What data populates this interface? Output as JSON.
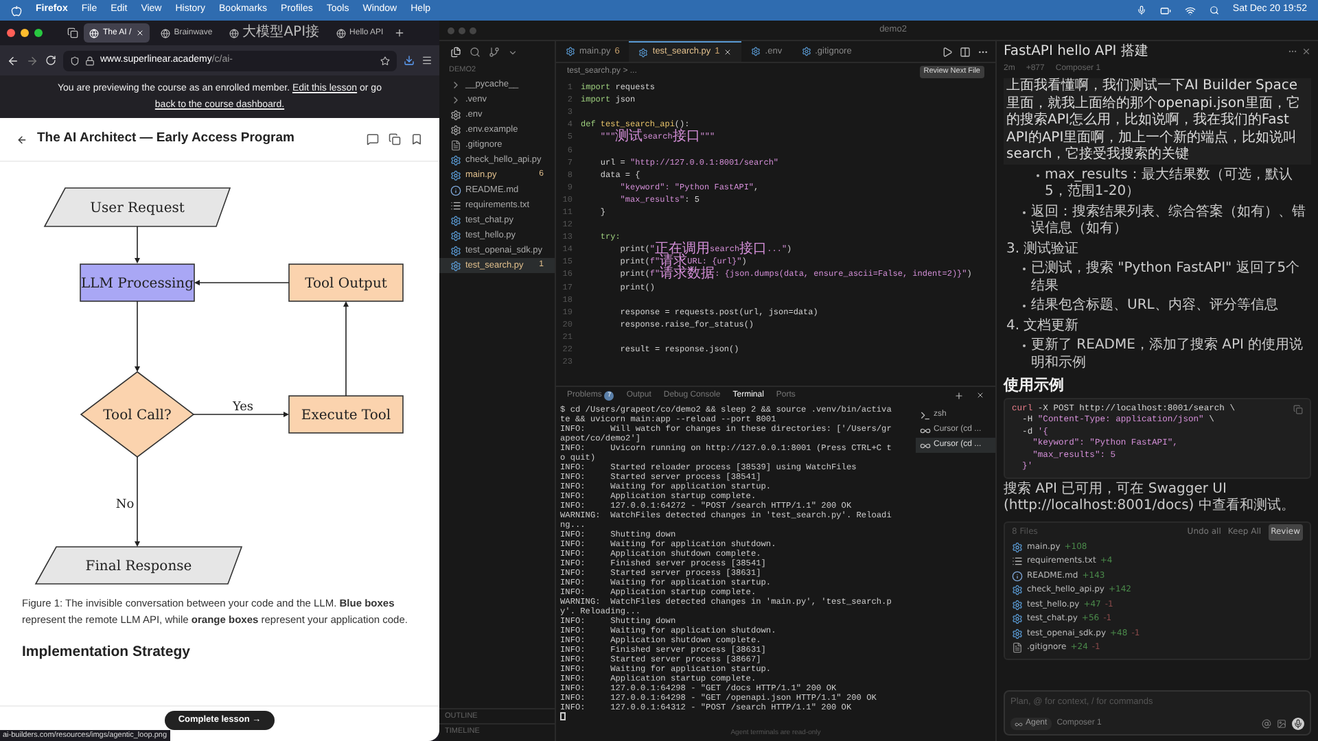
{
  "menubar": {
    "items": [
      "Firefox",
      "File",
      "Edit",
      "View",
      "History",
      "Bookmarks",
      "Profiles",
      "Tools",
      "Window",
      "Help"
    ],
    "clock": "Sat Dec 20  19:52"
  },
  "browser": {
    "tabs": [
      {
        "label": "The AI /",
        "selected": true
      },
      {
        "label": "Brainwave",
        "selected": false
      },
      {
        "label": "大模型API接",
        "selected": false
      },
      {
        "label": "Hello API",
        "selected": false
      }
    ],
    "url_host": "www.superlinear.academy",
    "url_path": "/c/ai-",
    "banner": {
      "text": "You are previewing the course as an enrolled member.",
      "link1": "Edit this lesson",
      "middle": "or go",
      "link2": "back to the course dashboard."
    },
    "page_title": "The AI Architect — Early Access Program",
    "diagram": {
      "nodes": [
        {
          "label": "User Request",
          "kind": "io",
          "color": "#e6e6e6"
        },
        {
          "label": "LLM Processing",
          "kind": "process",
          "color": "#a9a7f5"
        },
        {
          "label": "Tool Output",
          "kind": "process",
          "color": "#fbd3ae"
        },
        {
          "label": "Tool Call?",
          "kind": "decision",
          "color": "#fbd3ae"
        },
        {
          "label": "Execute Tool",
          "kind": "process",
          "color": "#fbd3ae"
        },
        {
          "label": "Final Response",
          "kind": "io",
          "color": "#e6e6e6"
        }
      ],
      "yes": "Yes",
      "no": "No"
    },
    "caption": "Figure 1: The invisible conversation between your code and the LLM. **Blue boxes** represent the remote LLM API, while **orange boxes** represent your application code.",
    "section_heading": "Implementation Strategy",
    "complete_button": "Complete lesson →",
    "status_url": "ai-builders.com/resources/imgs/agentic_loop.png"
  },
  "ide": {
    "title": "demo2",
    "explorer": {
      "heading": "DEMO2",
      "items": [
        {
          "name": "__pycache__",
          "kind": "folder",
          "selected": false
        },
        {
          "name": ".venv",
          "kind": "folder",
          "selected": false
        },
        {
          "name": ".env",
          "kind": "env",
          "selected": false
        },
        {
          "name": ".env.example",
          "kind": "env",
          "selected": false
        },
        {
          "name": ".gitignore",
          "kind": "text",
          "selected": false
        },
        {
          "name": "check_hello_api.py",
          "kind": "py",
          "selected": false
        },
        {
          "name": "main.py",
          "kind": "py",
          "badge": "6",
          "selected": false
        },
        {
          "name": "README.md",
          "kind": "info",
          "selected": false
        },
        {
          "name": "requirements.txt",
          "kind": "list",
          "selected": false
        },
        {
          "name": "test_chat.py",
          "kind": "py",
          "selected": false
        },
        {
          "name": "test_hello.py",
          "kind": "py",
          "selected": false
        },
        {
          "name": "test_openai_sdk.py",
          "kind": "py",
          "selected": false
        },
        {
          "name": "test_search.py",
          "kind": "py",
          "badge": "1",
          "selected": true
        }
      ],
      "sections": [
        "OUTLINE",
        "TIMELINE"
      ]
    },
    "editor": {
      "tabs": [
        {
          "label": "main.py",
          "badge": "6",
          "selected": false
        },
        {
          "label": "test_search.py",
          "badge": "1",
          "selected": true
        },
        {
          "label": ".env",
          "selected": false
        },
        {
          "label": ".gitignore",
          "selected": false
        }
      ],
      "breadcrumb": "test_search.py > ...",
      "review_button": "Review Next File",
      "lines": [
        {
          "n": "1",
          "t": [
            {
              "text": "import ",
              "kind": "kw"
            },
            {
              "text": "requests",
              "kind": "p"
            }
          ]
        },
        {
          "n": "2",
          "t": [
            {
              "text": "import ",
              "kind": "kw"
            },
            {
              "text": "json",
              "kind": "p"
            }
          ]
        },
        {
          "n": "3"
        },
        {
          "n": "4",
          "t": [
            {
              "text": "def ",
              "kind": "kw"
            },
            {
              "text": "test_search_api",
              "kind": "fn"
            },
            {
              "text": "():",
              "kind": "p"
            }
          ]
        },
        {
          "n": "5",
          "t": [
            {
              "text": "    \"\"\"",
              "kind": "str"
            },
            {
              "text": "测试",
              "kind": "str"
            },
            {
              "text": "search",
              "kind": "str"
            },
            {
              "text": "接口",
              "kind": "str"
            },
            {
              "text": "\"\"\"",
              "kind": "str"
            }
          ]
        },
        {
          "n": "6"
        },
        {
          "n": "7",
          "t": [
            {
              "text": "    url = ",
              "kind": "p"
            },
            {
              "text": "\"http://127.0.0.1:8001/search\"",
              "kind": "str"
            }
          ]
        },
        {
          "n": "8",
          "t": [
            {
              "text": "    data = {",
              "kind": "p"
            }
          ]
        },
        {
          "n": "9",
          "t": [
            {
              "text": "        \"keyword\": \"Python FastAPI\"",
              "kind": "str"
            },
            {
              "text": ",",
              "kind": "p"
            }
          ]
        },
        {
          "n": "10",
          "t": [
            {
              "text": "        \"max_results\"",
              "kind": "str"
            },
            {
              "text": ": 5",
              "kind": "p"
            }
          ]
        },
        {
          "n": "11",
          "t": [
            {
              "text": "    }",
              "kind": "p"
            }
          ]
        },
        {
          "n": "12"
        },
        {
          "n": "13",
          "t": [
            {
              "text": "    try:",
              "kind": "kw"
            }
          ]
        },
        {
          "n": "14",
          "t": [
            {
              "text": "        print(",
              "kind": "p"
            },
            {
              "text": "\"",
              "kind": "str"
            },
            {
              "text": "正在调用",
              "kind": "str"
            },
            {
              "text": "search",
              "kind": "str"
            },
            {
              "text": "接口",
              "kind": "str"
            },
            {
              "text": "...\"",
              "kind": "str"
            },
            {
              "text": ")",
              "kind": "p"
            }
          ]
        },
        {
          "n": "15",
          "t": [
            {
              "text": "        print(",
              "kind": "p"
            },
            {
              "text": "f\"",
              "kind": "str"
            },
            {
              "text": "请求",
              "kind": "str"
            },
            {
              "text": "URL: {url}\"",
              "kind": "str"
            },
            {
              "text": ")",
              "kind": "p"
            }
          ]
        },
        {
          "n": "16",
          "t": [
            {
              "text": "        print(",
              "kind": "p"
            },
            {
              "text": "f\"",
              "kind": "str"
            },
            {
              "text": "请求数据",
              "kind": "str"
            },
            {
              "text": ": {json.dumps(data, ensure_ascii=False, indent=2)}\"",
              "kind": "str"
            },
            {
              "text": ")",
              "kind": "p"
            }
          ]
        },
        {
          "n": "17",
          "t": [
            {
              "text": "        print()",
              "kind": "p"
            }
          ]
        },
        {
          "n": "18"
        },
        {
          "n": "19",
          "t": [
            {
              "text": "        response = requests.post(url, json=data)",
              "kind": "p"
            }
          ]
        },
        {
          "n": "20",
          "t": [
            {
              "text": "        response.raise_for_status()",
              "kind": "p"
            }
          ]
        },
        {
          "n": "21"
        },
        {
          "n": "22",
          "t": [
            {
              "text": "        result = response.json()",
              "kind": "p"
            }
          ]
        },
        {
          "n": "23"
        }
      ]
    },
    "panel": {
      "tabs": [
        {
          "label": "Problems",
          "badge": "7",
          "selected": false
        },
        {
          "label": "Output",
          "selected": false
        },
        {
          "label": "Debug Console",
          "selected": false
        },
        {
          "label": "Terminal",
          "selected": true
        },
        {
          "label": "Ports",
          "selected": false
        }
      ],
      "terminal": [
        "$ cd /Users/grapeot/co/demo2 && sleep 2 && source .venv/bin/activa",
        "te && uvicorn main:app --reload --port 8001",
        "INFO:     Will watch for changes in these directories: ['/Users/gr",
        "apeot/co/demo2']",
        "INFO:     Uvicorn running on http://127.0.0.1:8001 (Press CTRL+C t",
        "o quit)",
        "INFO:     Started reloader process [38539] using WatchFiles",
        "INFO:     Started server process [38541]",
        "INFO:     Waiting for application startup.",
        "INFO:     Application startup complete.",
        "INFO:     127.0.0.1:64272 - \"POST /search HTTP/1.1\" 200 OK",
        "WARNING:  WatchFiles detected changes in 'test_search.py'. Reloadi",
        "ng...",
        "INFO:     Shutting down",
        "INFO:     Waiting for application shutdown.",
        "INFO:     Application shutdown complete.",
        "INFO:     Finished server process [38541]",
        "INFO:     Started server process [38631]",
        "INFO:     Waiting for application startup.",
        "INFO:     Application startup complete.",
        "WARNING:  WatchFiles detected changes in 'main.py', 'test_search.p",
        "y'. Reloading...",
        "INFO:     Shutting down",
        "INFO:     Waiting for application shutdown.",
        "INFO:     Application shutdown complete.",
        "INFO:     Finished server process [38631]",
        "INFO:     Started server process [38667]",
        "INFO:     Waiting for application startup.",
        "INFO:     Application startup complete.",
        "INFO:     127.0.0.1:64298 - \"GET /docs HTTP/1.1\" 200 OK",
        "INFO:     127.0.0.1:64298 - \"GET /openapi.json HTTP/1.1\" 200 OK",
        "INFO:     127.0.0.1:64312 - \"POST /search HTTP/1.1\" 200 OK"
      ],
      "sessions": [
        {
          "label": "zsh",
          "kind": "shell",
          "selected": false
        },
        {
          "label": "Cursor (cd ...",
          "kind": "agent",
          "selected": false
        },
        {
          "label": "Cursor (cd ...",
          "kind": "agent",
          "selected": true
        }
      ],
      "footer": "Agent terminals are read-only"
    }
  },
  "chat": {
    "title": "FastAPI hello API 搭建",
    "meta": [
      "2m",
      "+877",
      "Composer 1"
    ],
    "message": "上面我看懂啊，我们测试一下AI Builder Space里面，就我上面给的那个openapi.json里面，它的搜索API怎么用，比如说啊，我在我们的Fast API的API里面啊，加上一个新的端点，比如说叫search，它接受我搜索的关键",
    "blocks": [
      {
        "kind": "sub",
        "text": "max_results：最大结果数（可选，默认5，范围1-20）"
      },
      {
        "kind": "bullet",
        "text": "返回：搜索结果列表、综合答案（如有）、错误信息（如有）"
      },
      {
        "kind": "num",
        "text": "3. 测试验证"
      },
      {
        "kind": "bullet",
        "text": "已测试，搜索 \"Python FastAPI\" 返回了5个结果"
      },
      {
        "kind": "bullet",
        "text": "结果包含标题、URL、内容、评分等信息"
      },
      {
        "kind": "num",
        "text": "4. 文档更新"
      },
      {
        "kind": "bullet",
        "text": "更新了 README，添加了搜索 API 的使用说明和示例"
      },
      {
        "kind": "heading",
        "text": "使用示例"
      },
      {
        "kind": "code",
        "lines": [
          [
            {
              "text": "curl",
              "kind": "cmd"
            },
            {
              "text": " -X POST http://localhost:8001/search \\",
              "kind": "p"
            }
          ],
          [
            {
              "text": "  -H ",
              "kind": "p"
            },
            {
              "text": "\"Content-Type: application/json\"",
              "kind": "str"
            },
            {
              "text": " \\",
              "kind": "p"
            }
          ],
          [
            {
              "text": "  -d ",
              "kind": "p"
            },
            {
              "text": "'{",
              "kind": "str"
            }
          ],
          [
            {
              "text": "    \"keyword\": \"Python FastAPI\",",
              "kind": "str"
            }
          ],
          [
            {
              "text": "    \"max_results\": 5",
              "kind": "str"
            }
          ],
          [
            {
              "text": "  }'",
              "kind": "str"
            }
          ]
        ]
      },
      {
        "kind": "text",
        "text": "搜索 API 已可用，可在 Swagger UI (http://localhost:8001/docs) 中查看和测试。"
      }
    ],
    "files": {
      "count": "8 Files",
      "undo": "Undo all",
      "keep": "Keep All",
      "review": "Review",
      "items": [
        {
          "name": "main.py",
          "kind": "py",
          "added": "+108"
        },
        {
          "name": "requirements.txt",
          "kind": "list",
          "added": "+4"
        },
        {
          "name": "README.md",
          "kind": "info",
          "added": "+143"
        },
        {
          "name": "check_hello_api.py",
          "kind": "py",
          "added": "+142"
        },
        {
          "name": "test_hello.py",
          "kind": "py",
          "added": "+47",
          "removed": "-1"
        },
        {
          "name": "test_chat.py",
          "kind": "py",
          "added": "+56",
          "removed": "-1"
        },
        {
          "name": "test_openai_sdk.py",
          "kind": "py",
          "added": "+48",
          "removed": "-1"
        },
        {
          "name": ".gitignore",
          "kind": "text",
          "added": "+24",
          "removed": "-1"
        }
      ]
    },
    "input": {
      "placeholder": "Plan, @ for context, / for commands",
      "mode": "Agent",
      "model": "Composer 1"
    }
  }
}
